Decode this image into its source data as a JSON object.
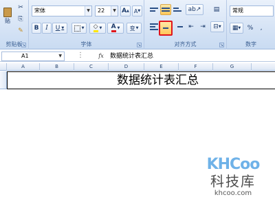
{
  "clipboard": {
    "paste_label": "贴",
    "group_label": "剪贴板"
  },
  "font": {
    "name": "宋体",
    "size": "22",
    "grow_label": "A",
    "shrink_label": "A",
    "bold": "B",
    "italic": "I",
    "underline": "U",
    "color_label": "A",
    "phonetic_label": "变",
    "group_label": "字体"
  },
  "alignment": {
    "group_label": "对齐方式"
  },
  "number": {
    "format": "常规",
    "percent": "%",
    "comma": ",",
    "group_label": "数字"
  },
  "formula_bar": {
    "cell_ref": "A1",
    "fx": "fx",
    "content": "数据统计表汇总"
  },
  "columns": [
    "A",
    "B",
    "C",
    "D",
    "E",
    "F",
    "G"
  ],
  "sheet": {
    "title": "数据统计表汇总"
  },
  "watermark": {
    "logo": "KHCoo",
    "name": "科技库",
    "url": "khcoo.com"
  }
}
